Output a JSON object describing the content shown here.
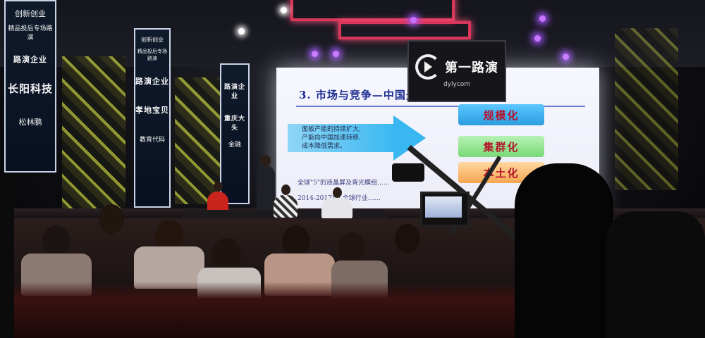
{
  "banners": {
    "left": {
      "lines": [
        "创新创业",
        "精品投后专场路演",
        "路演企业",
        "长阳科技",
        "松林鹏"
      ]
    },
    "mid": {
      "lines": [
        "创新创业",
        "精品投后专场路演",
        "路演企业",
        "孝地宝贝",
        "教育代码"
      ]
    },
    "right": {
      "lines": [
        "路演企业",
        "重庆大头",
        "金融"
      ]
    }
  },
  "slide": {
    "title": "3. 市场与竞争—中国光学膜发展趋势",
    "arrow_text": [
      "面板产能的持续扩大,",
      "产能向中国加速转移,",
      "成本降低需求。"
    ],
    "boxes": [
      "规模化",
      "集群化",
      "本土化"
    ],
    "bullets": [
      "全球\"5\"的液晶屏及背光模组……",
      "2014-2017年: 全球行业……"
    ]
  },
  "logo": {
    "name": "第一路演",
    "url": "dylycom"
  }
}
